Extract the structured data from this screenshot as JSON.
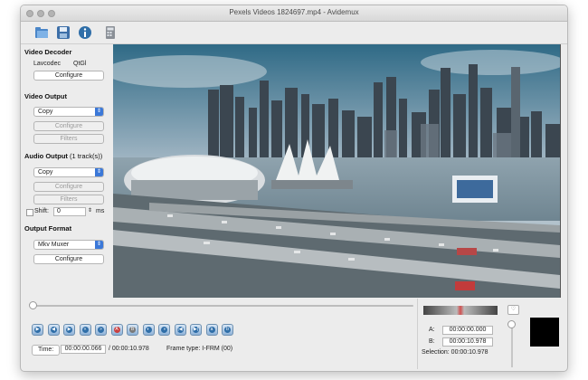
{
  "window": {
    "title": "Pexels Videos 1824697.mp4 - Avidemux"
  },
  "toolbar": {
    "buttons": [
      {
        "icon": "open-icon"
      },
      {
        "icon": "save-icon"
      },
      {
        "icon": "info-icon"
      },
      {
        "icon": "calculator-icon"
      }
    ]
  },
  "video_decoder": {
    "title": "Video Decoder",
    "codec": "Lavcodec",
    "codec2": "QtGl",
    "configure_label": "Configure"
  },
  "video_output": {
    "title": "Video Output",
    "selected": "Copy",
    "configure_label": "Configure",
    "filters_label": "Filters"
  },
  "audio_output": {
    "title": "Audio Output",
    "tracks": "(1 track(s))",
    "selected": "Copy",
    "configure_label": "Configure",
    "filters_label": "Filters",
    "shift_label": "Shift:",
    "shift_value": "0",
    "shift_unit": "ms"
  },
  "output_format": {
    "title": "Output Format",
    "selected": "Mkv Muxer",
    "configure_label": "Configure"
  },
  "playback": {
    "time_label": "Time:",
    "current_time": "00:00:00.066",
    "total_time": "/ 00:00:10.978",
    "frame_type": "Frame type:  I-FRM (00)",
    "position_fraction": 0.006
  },
  "selection": {
    "a_label": "A:",
    "a_value": "00:00:00.000",
    "b_label": "B:",
    "b_value": "00:00:10.978",
    "selection_label": "Selection: 00:00:10.978"
  },
  "controls": [
    "play-icon",
    "previous-frame-icon",
    "next-frame-icon",
    "previous-keyframe-icon",
    "next-keyframe-icon",
    "set-marker-a-icon",
    "set-marker-b-icon",
    "previous-black-frame-icon",
    "next-black-frame-icon",
    "first-frame-icon",
    "last-frame-icon",
    "goto-marker-a-icon",
    "goto-marker-b-icon"
  ],
  "colors": {
    "accent": "#3b78d8",
    "titlebar": "#e3e3e3",
    "panel": "#ececec"
  }
}
